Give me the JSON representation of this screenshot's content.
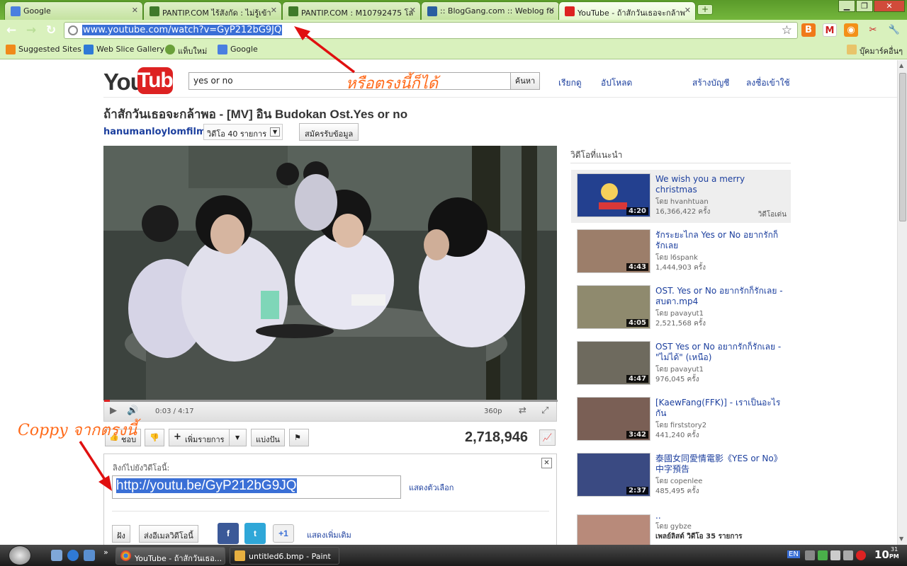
{
  "browser": {
    "tabs": [
      {
        "title": "Google",
        "active": false
      },
      {
        "title": "PANTIP.COM ไร้สังกัด : ไม่รู้เข้า",
        "active": false
      },
      {
        "title": "PANTIP.COM : M10792475 โล",
        "active": false
      },
      {
        "title": ":: BlogGang.com :: Weblog fo",
        "active": false
      },
      {
        "title": "YouTube - ถ้าสักวันเธอจะกล้าพ",
        "active": true
      }
    ],
    "new_tab": "+",
    "url": "www.youtube.com/watch?v=GyP212bG9JQ",
    "bookmarks": [
      "Suggested Sites",
      "Web Slice Gallery",
      "แท็บใหม่",
      "Google"
    ],
    "other_bookmarks": "บุ๊คมาร์คอื่นๆ"
  },
  "youtube": {
    "logo_you": "You",
    "logo_tube": "Tube",
    "search_value": "yes or no",
    "search_button": "ค้นหา",
    "top_links": [
      "เรียกดู",
      "อัปโหลด"
    ],
    "account_links": [
      "สร้างบัญชี",
      "ลงชื่อเข้าใช้"
    ],
    "video_title": "ถ้าสักวันเธอจะกล้าพอ - [MV] อิน Budokan Ost.Yes or no",
    "channel": "hanumanloylomfilm",
    "videos_count": "วิดีโอ 40 รายการ",
    "subscribe": "สมัครรับข้อมูล",
    "player": {
      "time": "0:03 / 4:17",
      "quality": "360p",
      "progress_fraction": 0.012
    },
    "actions": {
      "like": "ชอบ",
      "add_to": "เพิ่มรายการ",
      "share": "แบ่งปัน",
      "views": "2,718,946"
    },
    "share_panel": {
      "label": "ลิงก์ไปยังวิดีโอนี้:",
      "url": "http://youtu.be/GyP212bG9JQ",
      "options": "แสดงตัวเลือก",
      "embed": "ฝัง",
      "email": "ส่งอีเมลวิดีโอนี้",
      "gplus": "+1",
      "more": "แสดงเพิ่มเติม"
    },
    "recommended_heading": "วิดีโอที่แนะนำ",
    "recommended": [
      {
        "title": "We wish you a merry christmas",
        "by": "โดย hvanhtuan",
        "views": "16,366,422 ครั้ง",
        "duration": "4:20",
        "badge": "วิดีโอเด่น"
      },
      {
        "title": "รักระยะไกล Yes or No อยากรักก็รักเลย",
        "by": "โดย l6spank",
        "views": "1,444,903 ครั้ง",
        "duration": "4:43"
      },
      {
        "title": "OST. Yes or No อยากรักก็รักเลย - สบตา.mp4",
        "by": "โดย pavayut1",
        "views": "2,521,568 ครั้ง",
        "duration": "4:05"
      },
      {
        "title": "OST Yes or No อยากรักก็รักเลย - \"ไม่ได้\" (เหนือ)",
        "by": "โดย pavayut1",
        "views": "976,045 ครั้ง",
        "duration": "4:47"
      },
      {
        "title": "[KaewFang(FFK)] - เราเป็นอะไรกัน",
        "by": "โดย firststory2",
        "views": "441,240 ครั้ง",
        "duration": "3:42"
      },
      {
        "title": "泰國女同愛情電影《YES or No》中字預告",
        "by": "โดย copenlee",
        "views": "485,495 ครั้ง",
        "duration": "2:37"
      },
      {
        "title": "..",
        "by": "โดย gybze",
        "views": "เพลย์ลิสต์ วิดีโอ 35 รายการ",
        "duration": ""
      }
    ]
  },
  "annotations": {
    "omnibox_hint": "หรือตรงนี้ก็ได้",
    "copy_hint": "Coppy จากตรงนี้"
  },
  "taskbar": {
    "items": [
      "YouTube - ถ้าสักวันเธอ...",
      "untitled6.bmp - Paint"
    ],
    "lang": "EN",
    "clock": "10",
    "clock_suffix": "PM",
    "clock_min": "31"
  },
  "colors": {
    "chrome_green": "#74b63c",
    "link_blue": "#1c3f9e",
    "youtube_red": "#d22",
    "annotation_orange": "#ff6a1a",
    "arrow_red": "#e01010"
  }
}
